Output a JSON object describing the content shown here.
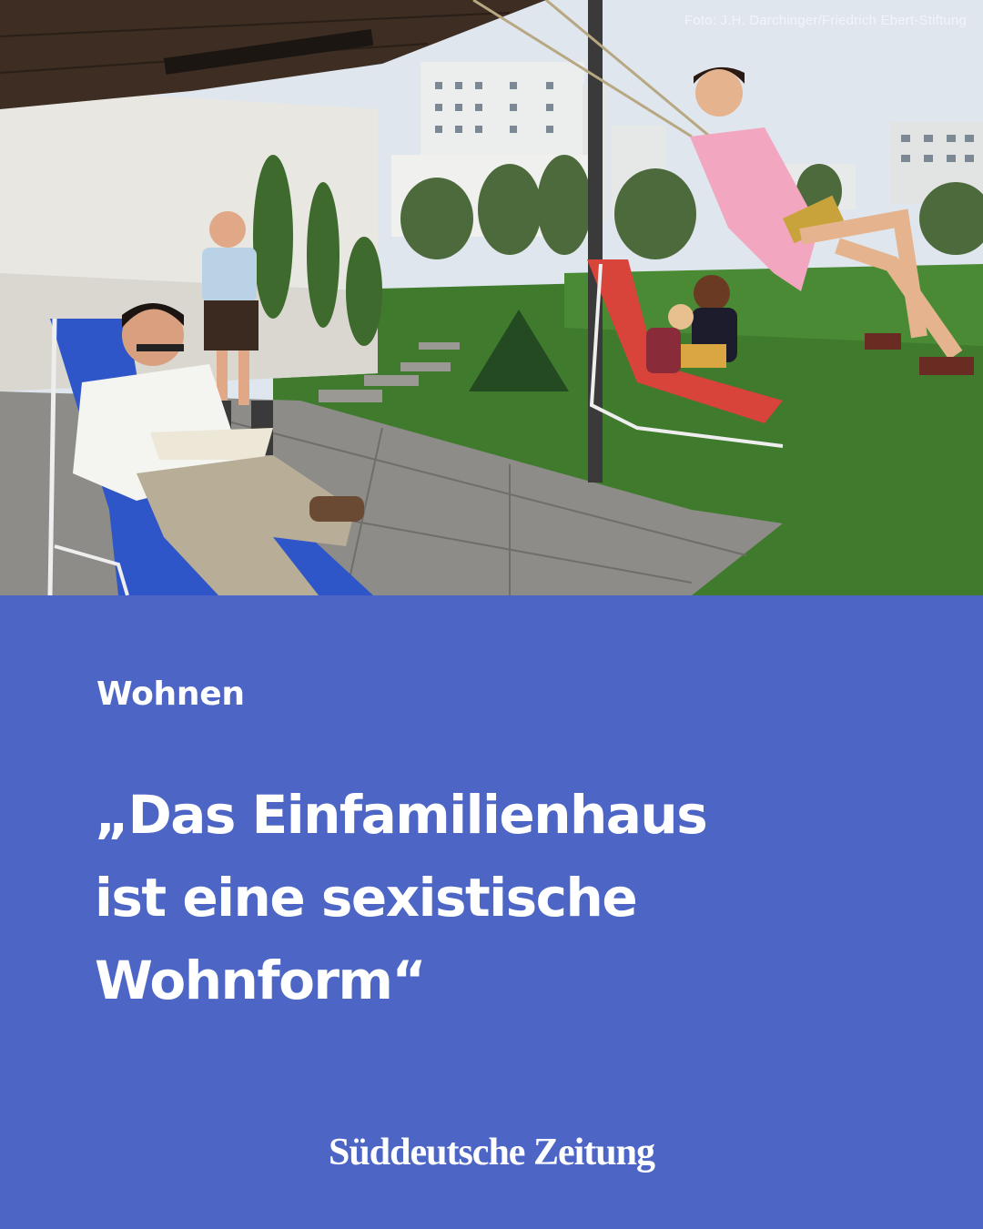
{
  "photo": {
    "credit": "Foto: J.H. Darchinger/Friedrich Ebert-Stiftung"
  },
  "article": {
    "kicker": "Wohnen",
    "headline_lines": [
      "„Das Einfamilienhaus",
      "ist eine sexistische",
      "Wohnform“"
    ]
  },
  "brand": {
    "name": "Süddeutsche Zeitung"
  },
  "colors": {
    "panel_bg": "#4d66c6",
    "text": "#ffffff"
  }
}
